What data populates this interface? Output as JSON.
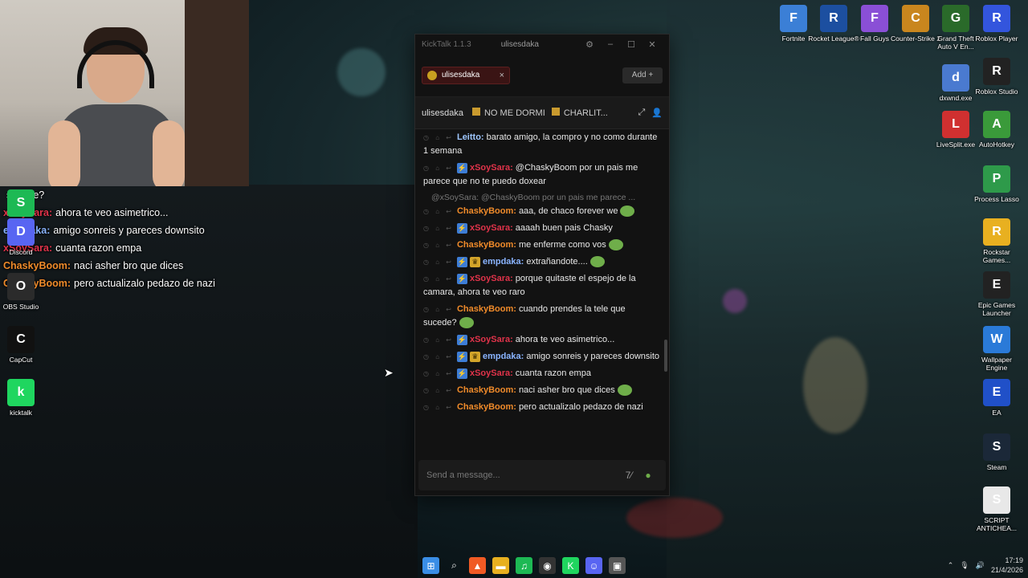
{
  "window": {
    "app_title": "KickTalk 1.1.3",
    "user": "ulisesdaka",
    "minimize": "–",
    "maximize": "☐",
    "close": "✕"
  },
  "tabs": [
    {
      "label": "ulisesdaka"
    }
  ],
  "add_button": "Add",
  "channel_header": {
    "channel": "ulisesdaka",
    "pinned": "NO ME DORMI",
    "pinned2": "CHARLIT..."
  },
  "messages": [
    {
      "user": "Leitto:",
      "color": "#9fc7ff",
      "text": "barato amigo, la compro y no como durante 1 semana",
      "badges": []
    },
    {
      "user": "xSoySara:",
      "color": "#e0334a",
      "text": "@ChaskyBoom por un pais me parece que no te puedo doxear",
      "badges": [
        "blue"
      ]
    },
    {
      "reply": "@xSoySara: @ChaskyBoom por un pais me parece ..."
    },
    {
      "user": "ChaskyBoom:",
      "color": "#f08b2a",
      "text": "aaa, de chaco forever we",
      "badges": [],
      "emote": true
    },
    {
      "user": "xSoySara:",
      "color": "#e0334a",
      "text": "aaaah buen pais Chasky",
      "badges": [
        "blue"
      ]
    },
    {
      "user": "ChaskyBoom:",
      "color": "#f08b2a",
      "text": "me enferme como vos",
      "badges": [],
      "emote": true
    },
    {
      "user": "empdaka:",
      "color": "#8ab4ff",
      "text": "extrañandote....",
      "badges": [
        "blue",
        "gold"
      ],
      "emote": true
    },
    {
      "user": "xSoySara:",
      "color": "#e0334a",
      "text": "porque quitaste el espejo de la camara, ahora te veo raro",
      "badges": [
        "blue"
      ]
    },
    {
      "user": "ChaskyBoom:",
      "color": "#f08b2a",
      "text": "cuando prendes la tele que sucede?",
      "badges": [],
      "emote": true
    },
    {
      "user": "xSoySara:",
      "color": "#e0334a",
      "text": "ahora te veo asimetrico...",
      "badges": [
        "blue"
      ]
    },
    {
      "user": "empdaka:",
      "color": "#8ab4ff",
      "text": "amigo sonreis y pareces downsito",
      "badges": [
        "blue",
        "gold"
      ]
    },
    {
      "user": "xSoySara:",
      "color": "#e0334a",
      "text": "cuanta razon empa",
      "badges": [
        "blue"
      ]
    },
    {
      "user": "ChaskyBoom:",
      "color": "#f08b2a",
      "text": "naci asher bro que dices",
      "badges": [],
      "emote": true
    },
    {
      "user": "ChaskyBoom:",
      "color": "#f08b2a",
      "text": "pero actualizalo pedazo de nazi",
      "badges": []
    }
  ],
  "input": {
    "placeholder": "Send a message..."
  },
  "overlay_chat": [
    {
      "user": "",
      "text": "sucede?",
      "color": "#ffffff"
    },
    {
      "user": "xSoySara:",
      "text": "ahora te veo asimetrico...",
      "color": "#e0334a"
    },
    {
      "user": "empdaka:",
      "text": "amigo sonreis y pareces downsito",
      "color": "#8ab4ff"
    },
    {
      "user": "xSoySara:",
      "text": "cuanta razon empa",
      "color": "#e0334a"
    },
    {
      "user": "ChaskyBoom:",
      "text": "naci asher bro que dices",
      "color": "#f08b2a"
    },
    {
      "user": "ChaskyBoom:",
      "text": "pero actualizalo pedazo de nazi",
      "color": "#f08b2a"
    }
  ],
  "desktop_left": [
    {
      "label": "Spotify",
      "icon": "spotify-icon",
      "color": "#1db954"
    },
    {
      "label": "Discord",
      "icon": "discord-icon",
      "color": "#5865f2"
    },
    {
      "label": "OBS Studio",
      "icon": "obs-icon",
      "color": "#2b2b2b"
    },
    {
      "label": "CapCut",
      "icon": "capcut-icon",
      "color": "#111111"
    },
    {
      "label": "kicktalk",
      "icon": "kicktalk-icon",
      "color": "#1fd65f"
    }
  ],
  "desktop_top": [
    {
      "label": "Fortnite",
      "color": "#3b7fd6"
    },
    {
      "label": "Rocket League®",
      "color": "#1c4fa0"
    },
    {
      "label": "Fall Guys",
      "color": "#8a4fd6"
    },
    {
      "label": "Counter-Strike 2",
      "color": "#c9861e"
    },
    {
      "label": "Grand Theft Auto V En...",
      "color": "#2a6a2a"
    },
    {
      "label": "Roblox Player",
      "color": "#3355dd"
    }
  ],
  "desktop_right": [
    {
      "label": "Roblox Studio",
      "color": "#222222"
    },
    {
      "label": "dxwnd.exe",
      "color": "#4a7ad0"
    },
    {
      "label": "LiveSplit.exe",
      "color": "#d03030"
    },
    {
      "label": "AutoHotkey",
      "color": "#3a9a3a"
    },
    {
      "label": "Process Lasso",
      "color": "#2e9a4a"
    },
    {
      "label": "Rockstar Games...",
      "color": "#e8b020"
    },
    {
      "label": "Epic Games Launcher",
      "color": "#222222"
    },
    {
      "label": "Wallpaper Engine",
      "color": "#2a7ad8"
    },
    {
      "label": "EA",
      "color": "#2050c8"
    },
    {
      "label": "Steam",
      "color": "#1b2838"
    },
    {
      "label": "SCRIPT ANTICHEA...",
      "color": "#e8e8e8"
    }
  ],
  "clock": {
    "time": "17:19",
    "date": "21/4/2026"
  },
  "taskbar": [
    "windows-icon",
    "search-icon",
    "brave-icon",
    "folder-icon",
    "spotify-icon",
    "obs-icon",
    "kicktalk-icon",
    "discord-icon",
    "app-icon"
  ]
}
